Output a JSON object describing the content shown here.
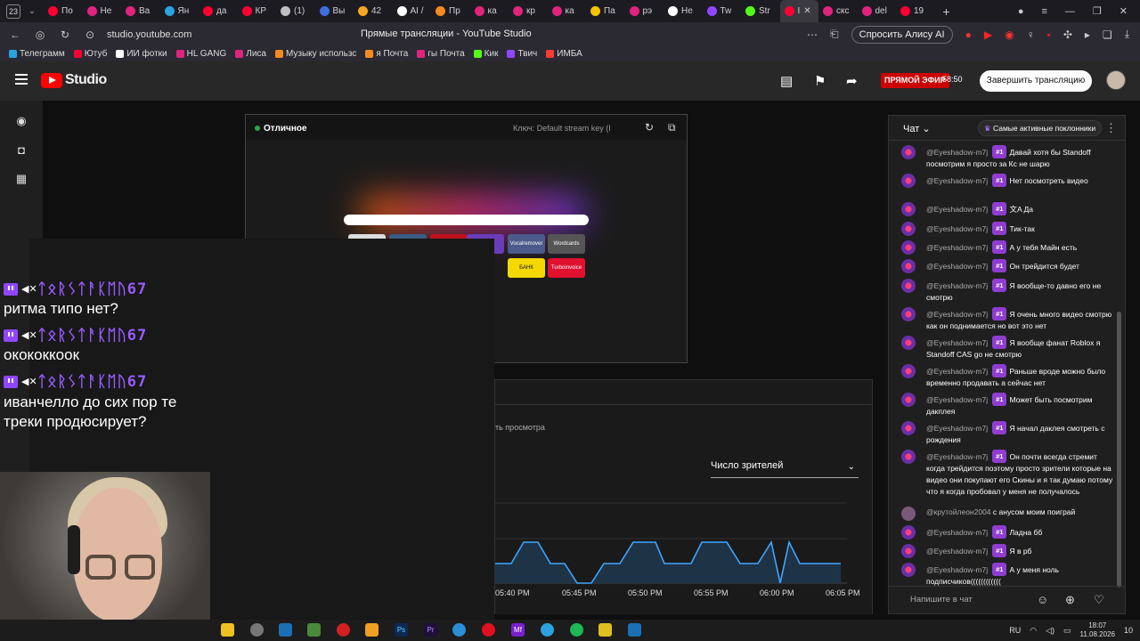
{
  "browser": {
    "tab_count": "23",
    "tabs": [
      {
        "label": "По",
        "color": "#ff0033"
      },
      {
        "label": "Не",
        "color": "#e0247e"
      },
      {
        "label": "Ва",
        "color": "#e0247e"
      },
      {
        "label": "Ян",
        "color": "#2aa3e0"
      },
      {
        "label": "да",
        "color": "#ff0033"
      },
      {
        "label": "КР",
        "color": "#ff0033"
      },
      {
        "label": "(1)",
        "color": "#c0c0c0"
      },
      {
        "label": "Вы",
        "color": "#3d6fe0"
      },
      {
        "label": "42",
        "color": "#f5a623"
      },
      {
        "label": "AI /",
        "color": "#ffffff"
      },
      {
        "label": "Пр",
        "color": "#f58a1f"
      },
      {
        "label": "ка",
        "color": "#e0247e"
      },
      {
        "label": "кр",
        "color": "#e0247e"
      },
      {
        "label": "ка",
        "color": "#e0247e"
      },
      {
        "label": "Па",
        "color": "#f5c400"
      },
      {
        "label": "рэ",
        "color": "#e0247e"
      },
      {
        "label": "Не",
        "color": "#ffffff"
      },
      {
        "label": "Tw",
        "color": "#9146ff"
      },
      {
        "label": "Str",
        "color": "#53fc18"
      },
      {
        "label": "I",
        "color": "#ff0033",
        "active": true
      },
      {
        "label": "скс",
        "color": "#e0247e"
      },
      {
        "label": "del",
        "color": "#e0247e"
      },
      {
        "label": "19",
        "color": "#ff0033"
      }
    ],
    "url": "studio.youtube.com",
    "page_title": "Прямые трансляции - YouTube Studio",
    "alisa_button": "Спросить Алису AI",
    "bookmarks": [
      {
        "label": "Телеграмм",
        "color": "#2aa3e0"
      },
      {
        "label": "Ютуб",
        "color": "#ff0033"
      },
      {
        "label": "ИИ фотки",
        "color": "#ffffff"
      },
      {
        "label": "HL GANG",
        "color": "#e0247e"
      },
      {
        "label": "Лиса",
        "color": "#e0247e"
      },
      {
        "label": "Музыку использс",
        "color": "#f58a1f"
      },
      {
        "label": "я Почта",
        "color": "#f58a1f"
      },
      {
        "label": "гы Почта",
        "color": "#e0247e"
      },
      {
        "label": "Кик",
        "color": "#53fc18"
      },
      {
        "label": "Твич",
        "color": "#9146ff"
      },
      {
        "label": "ИМБА",
        "color": "#ff3b30"
      }
    ]
  },
  "studio": {
    "logo_text": "Studio",
    "live_badge": "ПРЯМОЙ ЭФИР",
    "live_timer": "58:50",
    "end_button": "Завершить трансляцию"
  },
  "preview": {
    "status": "Отличное",
    "key_label": "Ключ: Default stream key (I",
    "tiles": [
      {
        "label": "Vocalremover",
        "color": "#4a5a8a"
      },
      {
        "label": "Wordcards",
        "color": "#555"
      },
      {
        "label": "БАНК",
        "color": "#f5d800"
      },
      {
        "label": "Turboinvoice",
        "color": "#e0102f"
      }
    ]
  },
  "analytics": {
    "partial_text": "ть просмотра",
    "metric_dropdown": "Число зрителей",
    "time_labels": [
      "05:40 PM",
      "05:45 PM",
      "05:50 PM",
      "05:55 PM",
      "06:00 PM",
      "06:05 PM"
    ]
  },
  "overlay_chat": [
    {
      "nick": "ᛏᛟᚱᛊᛏᚨᛕᛖᚢ67",
      "text": "ритма типо нет?"
    },
    {
      "nick": "ᛏᛟᚱᛊᛏᚨᛕᛖᚢ67",
      "text": "окококкоок"
    },
    {
      "nick": "ᛏᛟᚱᛊᛏᚨᛕᛖᚢ67",
      "text": "иванчелло до сих пор те треки продюсирует?"
    }
  ],
  "chat": {
    "title": "Чат",
    "top_fans": "Самые активные поклонники",
    "badge": "#1",
    "placeholder": "Напишите в чат",
    "messages": [
      {
        "name": "@Eyeshadow-m7j",
        "badge": true,
        "text": "Давай хотя бы Standoff посмотрим я просто за Кс не шарю"
      },
      {
        "name": "@Eyeshadow-m7j",
        "badge": true,
        "text": "Нет посмотреть видео"
      },
      {
        "name": "@Eyeshadow-m7j",
        "badge": true,
        "text": "文A Да"
      },
      {
        "name": "@Eyeshadow-m7j",
        "badge": true,
        "text": "Тик-так"
      },
      {
        "name": "@Eyeshadow-m7j",
        "badge": true,
        "text": "А у тебя Майн есть"
      },
      {
        "name": "@Eyeshadow-m7j",
        "badge": true,
        "text": "Он трейдится будет"
      },
      {
        "name": "@Eyeshadow-m7j",
        "badge": true,
        "text": "Я вообще-то давно его не смотрю"
      },
      {
        "name": "@Eyeshadow-m7j",
        "badge": true,
        "text": "Я очень много видео смотрю как он поднимается но вот это нет"
      },
      {
        "name": "@Eyeshadow-m7j",
        "badge": true,
        "text": "Я вообще фанат Roblox я Standoff CAS go не смотрю"
      },
      {
        "name": "@Eyeshadow-m7j",
        "badge": true,
        "text": "Раньше вроде можно было временно продавать а сейчас нет"
      },
      {
        "name": "@Eyeshadow-m7j",
        "badge": true,
        "text": "Может быть посмотрим дакплея"
      },
      {
        "name": "@Eyeshadow-m7j",
        "badge": true,
        "text": "Я начал даклея смотреть с рождения"
      },
      {
        "name": "@Eyeshadow-m7j",
        "badge": true,
        "text": "Он почти всегда стремит когда трейдится поэтому просто зрители которые на видео они покупают его Скины и я так думаю потому что я когда пробовал у меня не получалось"
      },
      {
        "name": "@крутойлеон2004",
        "badge": false,
        "text": "с анусом моим поиграй"
      },
      {
        "name": "@Eyeshadow-m7j",
        "badge": true,
        "text": "Ладна бб"
      },
      {
        "name": "@Eyeshadow-m7j",
        "badge": true,
        "text": "Я в рб"
      },
      {
        "name": "@Eyeshadow-m7j",
        "badge": true,
        "text": "А у меня ноль подписчиков(((((((((((("
      }
    ]
  },
  "taskbar": {
    "lang": "RU",
    "time": "18:07",
    "date": "11.08.2026",
    "notif": "10"
  }
}
